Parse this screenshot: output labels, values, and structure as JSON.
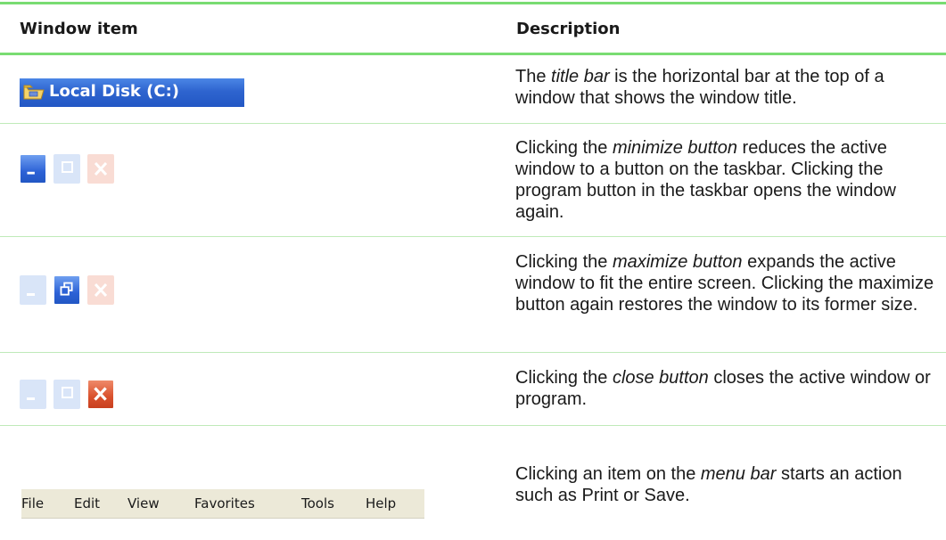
{
  "table": {
    "header": {
      "col1": "Window item",
      "col2": "Description"
    },
    "rows": [
      {
        "item": "title-bar",
        "title_text": "Local Disk (C:)",
        "desc_before": "The ",
        "desc_term": "title bar",
        "desc_after": " is the horizontal bar at the top of a window that shows the window title."
      },
      {
        "item": "minimize-button",
        "desc_before": "Clicking the ",
        "desc_term": "minimize button",
        "desc_after": " reduces the active window to a button on the taskbar. Clicking the program button in the taskbar opens the window again."
      },
      {
        "item": "maximize-button",
        "desc_before": "Clicking the ",
        "desc_term": "maximize button",
        "desc_after": " expands the active window to fit the entire screen. Clicking the maximize button again restores the window to its former size."
      },
      {
        "item": "close-button",
        "desc_before": "Clicking the ",
        "desc_term": "close button",
        "desc_after": " closes the active window or program."
      },
      {
        "item": "menu-bar",
        "desc_before": "Clicking an item on the ",
        "desc_term": "menu bar",
        "desc_after": " starts an action such as Print or Save."
      }
    ],
    "menu_items": [
      "File",
      "Edit",
      "View",
      "Favorites",
      "Tools",
      "Help"
    ]
  },
  "colors": {
    "rule": "#79dc72",
    "title_bar": "#2e64cf",
    "close_red": "#d9502c"
  },
  "icons": [
    "folder-icon",
    "minimize-icon",
    "maximize-icon",
    "close-icon"
  ]
}
